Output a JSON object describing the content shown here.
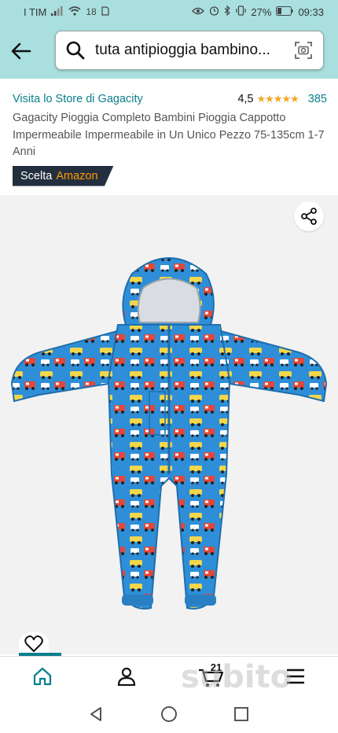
{
  "status_bar": {
    "carrier": "I TIM",
    "network": "18",
    "battery": "27%",
    "time": "09:33"
  },
  "search": {
    "query": "tuta antipioggia bambino..."
  },
  "product": {
    "store_link": "Visita lo Store di Gagacity",
    "rating_value": "4,5",
    "stars": "★★★★★",
    "stars_filled_fraction": 0.9,
    "review_count": "385",
    "title": "Gagacity Pioggia Completo Bambini Pioggia Cappotto Impermeabile Impermeabile in Un Unico Pezzo 75-135cm 1-7 Anni",
    "badge_prefix": "Scelta",
    "badge_brand": "Amazon"
  },
  "bottom_nav": {
    "cart_count": "21",
    "watermark": "subito"
  },
  "colors": {
    "header_bg": "#a9e0df",
    "accent": "#0b7f8c",
    "star": "#f5a623",
    "badge_bg": "#232f3e",
    "badge_brand": "#ff9900",
    "suit_blue": "#2e8fd8"
  },
  "icons": [
    "back-arrow-icon",
    "search-icon",
    "camera-search-icon",
    "share-icon",
    "heart-icon",
    "home-icon",
    "account-icon",
    "cart-icon",
    "menu-icon",
    "back-triangle-icon",
    "home-circle-icon",
    "recents-square-icon"
  ]
}
